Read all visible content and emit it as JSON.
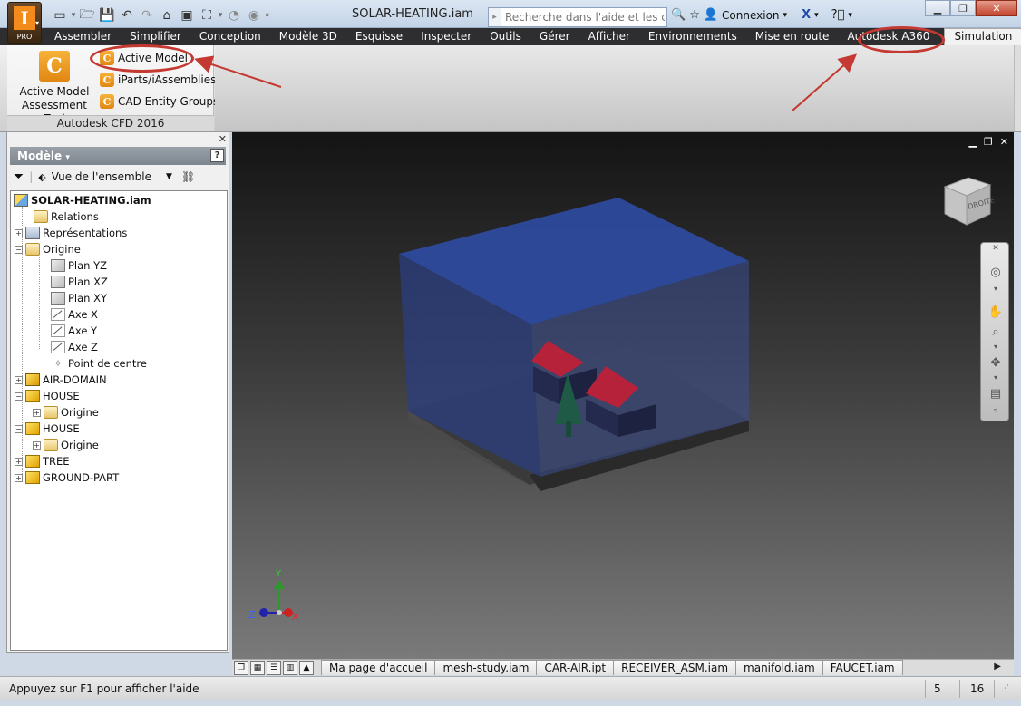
{
  "titlebar": {
    "document_title": "SOLAR-HEATING.iam",
    "search_placeholder": "Recherche dans l'aide et les com",
    "sign_in": "Connexion",
    "app_badge": "PRO",
    "app_letter": "I"
  },
  "ribbon_tabs": [
    "Assembler",
    "Simplifier",
    "Conception",
    "Modèle 3D",
    "Esquisse",
    "Inspecter",
    "Outils",
    "Gérer",
    "Afficher",
    "Environnements",
    "Mise en route",
    "Autodesk A360"
  ],
  "active_tab": "Simulation",
  "ribbon_panel": {
    "label": "Autodesk CFD 2016",
    "big_button_line1": "Active Model",
    "big_button_line2": "Assessment Tool",
    "items": [
      "Active Model",
      "iParts/iAssemblies",
      "CAD Entity Groups"
    ]
  },
  "browser": {
    "title": "Modèle",
    "view_label": "Vue de l'ensemble",
    "tree": [
      {
        "label": "SOLAR-HEATING.iam"
      },
      {
        "label": "Relations"
      },
      {
        "label": "Représentations"
      },
      {
        "label": "Origine"
      },
      {
        "label": "Plan YZ"
      },
      {
        "label": "Plan XZ"
      },
      {
        "label": "Plan XY"
      },
      {
        "label": "Axe X"
      },
      {
        "label": "Axe Y"
      },
      {
        "label": "Axe Z"
      },
      {
        "label": "Point de centre"
      },
      {
        "label": "AIR-DOMAIN"
      },
      {
        "label": "HOUSE"
      },
      {
        "label": "Origine"
      },
      {
        "label": "HOUSE"
      },
      {
        "label": "Origine"
      },
      {
        "label": "TREE"
      },
      {
        "label": "GROUND-PART"
      }
    ]
  },
  "viewcube": {
    "face_label": "DROITE"
  },
  "triad": {
    "x": "X",
    "y": "Y",
    "z": "Z"
  },
  "document_tabs": [
    "Ma page d'accueil",
    "mesh-study.iam",
    "CAR-AIR.ipt",
    "RECEIVER_ASM.iam",
    "manifold.iam",
    "FAUCET.iam"
  ],
  "statusbar": {
    "help_text": "Appuyez sur F1 pour afficher l'aide",
    "count_1": "5",
    "count_2": "16"
  },
  "colors": {
    "annotation": "#c43a32",
    "air_domain": "#2e4a9e",
    "house_roof": "#b5223a",
    "house_body": "#232a4e",
    "tree": "#1f5a46",
    "ground": "#2e2e2e"
  }
}
